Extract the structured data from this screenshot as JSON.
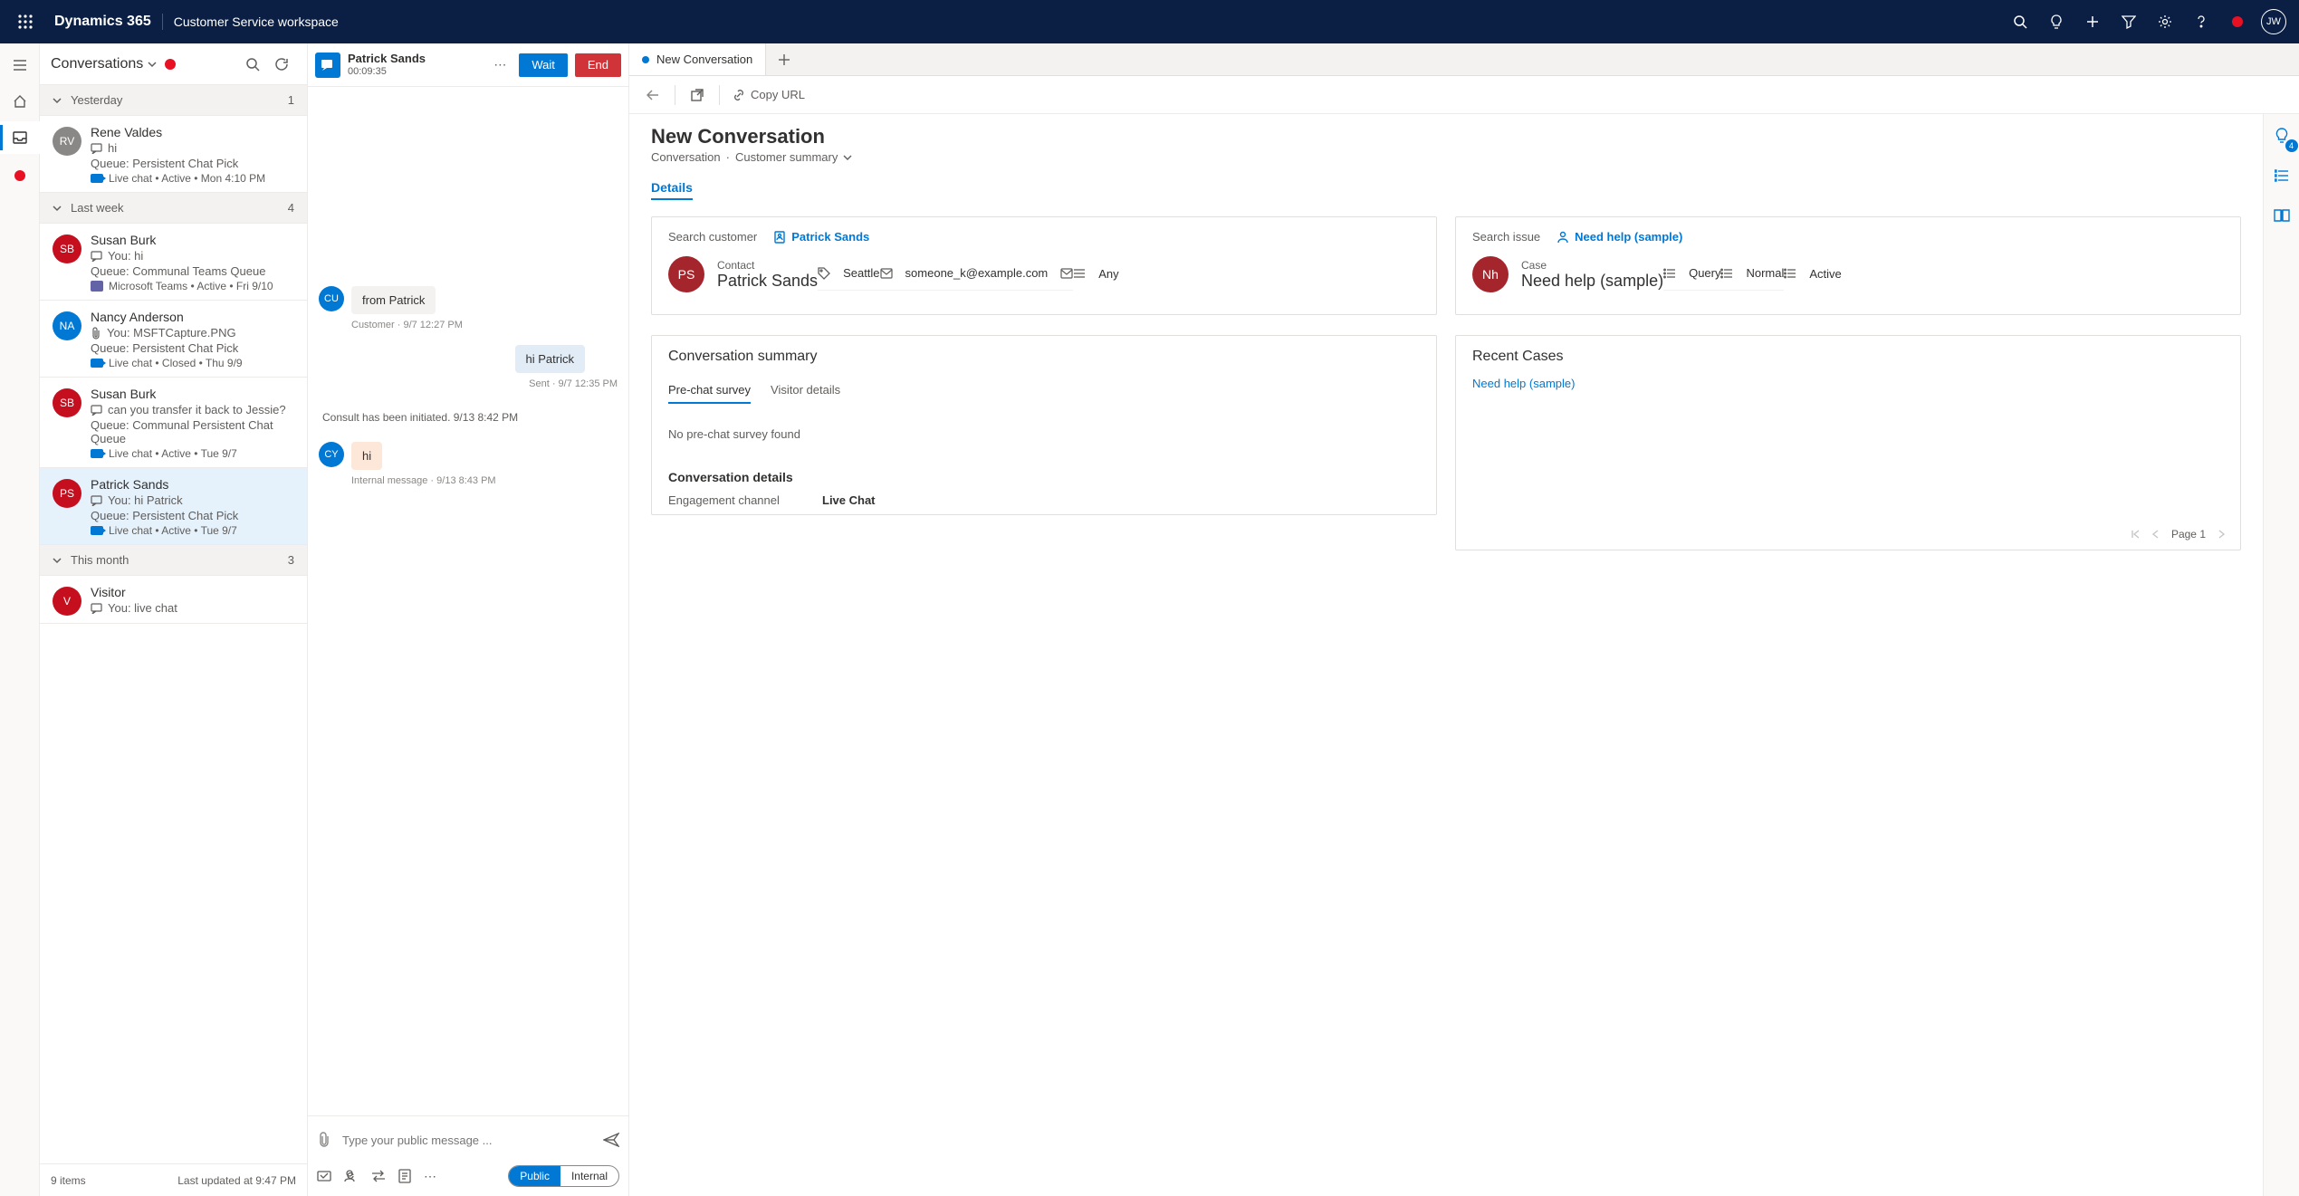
{
  "navbar": {
    "brand": "Dynamics 365",
    "workspace": "Customer Service workspace",
    "user_initials": "JW"
  },
  "conversations_panel": {
    "title": "Conversations",
    "groups": [
      {
        "label": "Yesterday",
        "count": "1"
      },
      {
        "label": "Last week",
        "count": "4"
      },
      {
        "label": "This month",
        "count": "3"
      }
    ],
    "items": [
      {
        "initials": "RV",
        "color": "#8a8886",
        "name": "Rene Valdes",
        "preview": "hi",
        "queue": "Queue: Persistent Chat Pick",
        "channel": "live",
        "meta": "Live chat  •  Active  •  Mon 4:10 PM"
      },
      {
        "initials": "SB",
        "color": "#c50f1f",
        "name": "Susan Burk",
        "preview": "You: hi",
        "queue": "Queue: Communal Teams Queue",
        "channel": "teams",
        "meta": "Microsoft Teams  •  Active  •  Fri 9/10"
      },
      {
        "initials": "NA",
        "color": "#0078d4",
        "name": "Nancy Anderson",
        "preview": "You: MSFTCapture.PNG",
        "queue": "Queue: Persistent Chat Pick",
        "channel": "live",
        "meta": "Live chat  •  Closed  •  Thu 9/9",
        "attach": true
      },
      {
        "initials": "SB",
        "color": "#c50f1f",
        "name": "Susan Burk",
        "preview": "can you transfer it back to Jessie?",
        "queue": "Queue: Communal Persistent Chat Queue",
        "channel": "live",
        "meta": "Live chat  •  Active  •  Tue 9/7"
      },
      {
        "initials": "PS",
        "color": "#c50f1f",
        "name": "Patrick Sands",
        "preview": "You: hi Patrick",
        "queue": "Queue: Persistent Chat Pick",
        "channel": "live",
        "meta": "Live chat  •  Active  •  Tue 9/7",
        "selected": true
      },
      {
        "initials": "V",
        "color": "#c50f1f",
        "name": "Visitor",
        "preview": "You: live chat",
        "queue": "",
        "channel": "",
        "meta": ""
      }
    ],
    "footer_count": "9 items",
    "footer_updated": "Last updated at 9:47 PM"
  },
  "chat": {
    "title": "Patrick Sands",
    "timer": "00:09:35",
    "wait_label": "Wait",
    "end_label": "End",
    "messages": [
      {
        "av": "CU",
        "avcolor": "#0078d4",
        "side": "left",
        "kind": "cust",
        "text": "from Patrick",
        "meta": "Customer · 9/7 12:27 PM"
      },
      {
        "side": "right",
        "kind": "me",
        "text": "hi Patrick",
        "meta": "Sent · 9/7 12:35 PM"
      }
    ],
    "system": "Consult has been initiated. 9/13 8:42 PM",
    "internal": {
      "av": "CY",
      "avcolor": "#0078d4",
      "text": "hi",
      "meta": "Internal message · 9/13 8:43 PM"
    },
    "compose_placeholder": "Type your public message ...",
    "toggle_public": "Public",
    "toggle_internal": "Internal"
  },
  "form": {
    "tab_label": "New Conversation",
    "copy_url": "Copy URL",
    "title": "New Conversation",
    "crumb1": "Conversation",
    "crumb2": "Customer summary",
    "section": "Details",
    "customer_card": {
      "search_label": "Search customer",
      "link": "Patrick Sands",
      "entity_label": "Contact",
      "entity_name": "Patrick Sands",
      "entity_initials": "PS",
      "fields": [
        "Seattle",
        "someone_k@example.com",
        "Any"
      ]
    },
    "issue_card": {
      "search_label": "Search issue",
      "link": "Need help (sample)",
      "entity_label": "Case",
      "entity_name": "Need help (sample)",
      "entity_initials": "Nh",
      "fields": [
        "Query",
        "Normal",
        "Active"
      ]
    },
    "conv_summary": {
      "title": "Conversation summary",
      "tab1": "Pre-chat survey",
      "tab2": "Visitor details",
      "empty": "No pre-chat survey found",
      "details_label": "Conversation details",
      "eng_channel_label": "Engagement channel",
      "eng_channel_value": "Live Chat"
    },
    "recent_cases": {
      "title": "Recent Cases",
      "item": "Need help (sample)",
      "page": "Page 1"
    }
  },
  "siderail": {
    "badge": "4"
  }
}
